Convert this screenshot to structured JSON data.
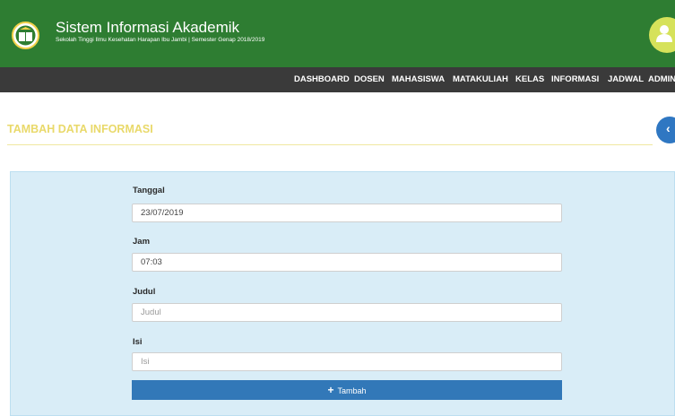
{
  "header": {
    "title": "Sistem Informasi Akademik",
    "subtitle": "Sekolah Tinggi Ilmu Kesehatan Harapan Ibu Jambi | Semester Genap 2018/2019",
    "logo_icon": "book-shield-logo",
    "avatar_icon": "user-icon",
    "bg_color": "#2e7d32"
  },
  "nav": {
    "items": [
      "DASHBOARD",
      "DOSEN",
      "MAHASISWA",
      "MATAKULIAH",
      "KELAS",
      "INFORMASI",
      "JADWAL",
      "ADMIN"
    ]
  },
  "page": {
    "title": "TAMBAH DATA INFORMASI",
    "back_icon": "chevron-left-icon"
  },
  "form": {
    "tanggal_label": "Tanggal",
    "tanggal_value": "23/07/2019",
    "jam_label": "Jam",
    "jam_value": "07:03",
    "judul_label": "Judul",
    "judul_placeholder": "Judul",
    "isi_label": "Isi",
    "isi_placeholder": "Isi",
    "submit_label": "Tambah",
    "submit_icon": "plus-icon"
  }
}
